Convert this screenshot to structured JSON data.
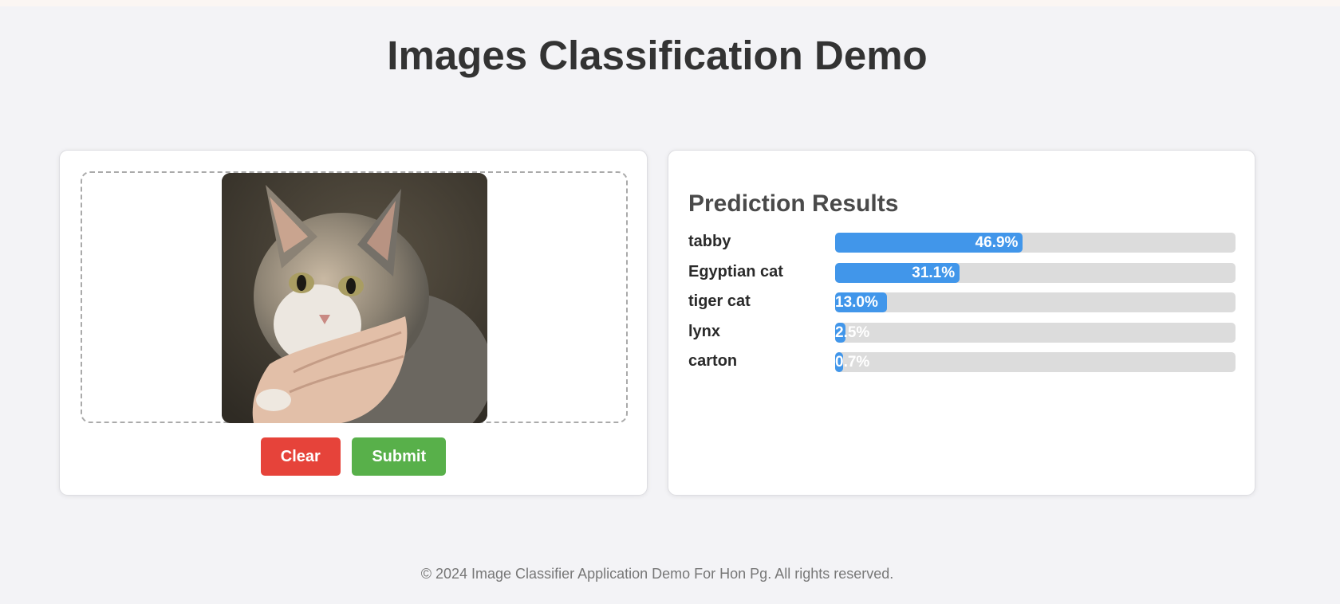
{
  "page": {
    "title": "Images Classification Demo"
  },
  "uploader": {
    "clear_label": "Clear",
    "submit_label": "Submit"
  },
  "results": {
    "heading": "Prediction Results",
    "predictions": [
      {
        "label": "tabby",
        "percent_text": "46.9%",
        "value": 46.9
      },
      {
        "label": "Egyptian cat",
        "percent_text": "31.1%",
        "value": 31.1
      },
      {
        "label": "tiger cat",
        "percent_text": "13.0%",
        "value": 13.0
      },
      {
        "label": "lynx",
        "percent_text": "2.5%",
        "value": 2.5
      },
      {
        "label": "carton",
        "percent_text": "0.7%",
        "value": 0.7
      }
    ]
  },
  "footer": {
    "text": "© 2024 Image Classifier Application Demo For Hon Pg. All rights reserved."
  },
  "colors": {
    "bar": "#4196ea",
    "track": "#dcdcdc",
    "clear": "#e6433a",
    "submit": "#58b04a"
  }
}
